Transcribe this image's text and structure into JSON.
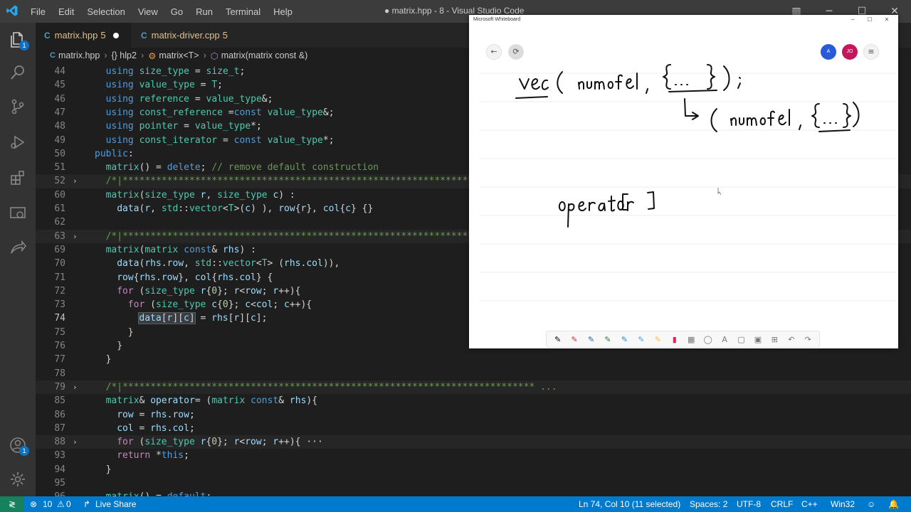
{
  "window": {
    "title": "● matrix.hpp - 8 - Visual Studio Code",
    "menu": [
      "File",
      "Edit",
      "Selection",
      "View",
      "Go",
      "Run",
      "Terminal",
      "Help"
    ]
  },
  "activity": {
    "explorer_badge": "1",
    "accounts_badge": "1"
  },
  "tabs": [
    {
      "icon": "C",
      "name": "matrix.hpp",
      "problems": "5",
      "modified": true
    },
    {
      "icon": "C",
      "name": "matrix-driver.cpp",
      "problems": "5",
      "modified": false
    }
  ],
  "breadcrumb": {
    "file": "matrix.hpp",
    "ns": "{} hlp2",
    "cls": "matrix<T>",
    "method": "matrix(matrix const &)"
  },
  "editor": {
    "current_line": "74",
    "lines": [
      {
        "n": "44",
        "code": "using size_type = size_t;"
      },
      {
        "n": "45",
        "code": "using value_type = T;"
      },
      {
        "n": "46",
        "code": "using reference = value_type&;"
      },
      {
        "n": "47",
        "code": "using const_reference =const value_type&;"
      },
      {
        "n": "48",
        "code": "using pointer = value_type*;"
      },
      {
        "n": "49",
        "code": "using const_iterator = const value_type*;"
      },
      {
        "n": "50",
        "code": "public:"
      },
      {
        "n": "51",
        "code": "matrix() = delete; // remove default construction"
      },
      {
        "n": "52",
        "code": "/*|********************************************************************************"
      },
      {
        "n": "60",
        "code": "matrix(size_type r, size_type c) :"
      },
      {
        "n": "61",
        "code": "data(r, std::vector<T>(c) ), row{r}, col{c} {}"
      },
      {
        "n": "62",
        "code": ""
      },
      {
        "n": "63",
        "code": "/*|********************************************************************************"
      },
      {
        "n": "69",
        "code": "matrix(matrix const& rhs) :"
      },
      {
        "n": "70",
        "code": "data(rhs.row, std::vector<T> (rhs.col)),"
      },
      {
        "n": "71",
        "code": "row{rhs.row}, col{rhs.col} {"
      },
      {
        "n": "72",
        "code": "for (size_type r{0}; r<row; r++){"
      },
      {
        "n": "73",
        "code": "for (size_type c{0}; c<col; c++){"
      },
      {
        "n": "74",
        "code": "data[r][c] = rhs[r][c];"
      },
      {
        "n": "75",
        "code": "}"
      },
      {
        "n": "76",
        "code": "}"
      },
      {
        "n": "77",
        "code": "}"
      },
      {
        "n": "78",
        "code": ""
      },
      {
        "n": "79",
        "code": "/*|************************************************************************** ..."
      },
      {
        "n": "85",
        "code": "matrix& operator= (matrix const& rhs){"
      },
      {
        "n": "86",
        "code": "row = rhs.row;"
      },
      {
        "n": "87",
        "code": "col = rhs.col;"
      },
      {
        "n": "88",
        "code": "for (size_type r{0}; r<row; r++){ ···"
      },
      {
        "n": "93",
        "code": "return *this;"
      },
      {
        "n": "94",
        "code": "}"
      },
      {
        "n": "95",
        "code": ""
      },
      {
        "n": "96",
        "code": "matrix() = default;"
      }
    ]
  },
  "whiteboard": {
    "title": "Microsoft Whiteboard",
    "avatar1": "A",
    "avatar2": "JO",
    "avatar1_color": "#2a5bd7",
    "avatar2_color": "#c2185b"
  },
  "statusbar": {
    "errors": "10",
    "warnings": "0",
    "live_share": "Live Share",
    "position": "Ln 74, Col 10 (11 selected)",
    "spaces": "Spaces: 2",
    "encoding": "UTF-8",
    "eol": "CRLF",
    "language": "C++",
    "platform": "Win32"
  }
}
